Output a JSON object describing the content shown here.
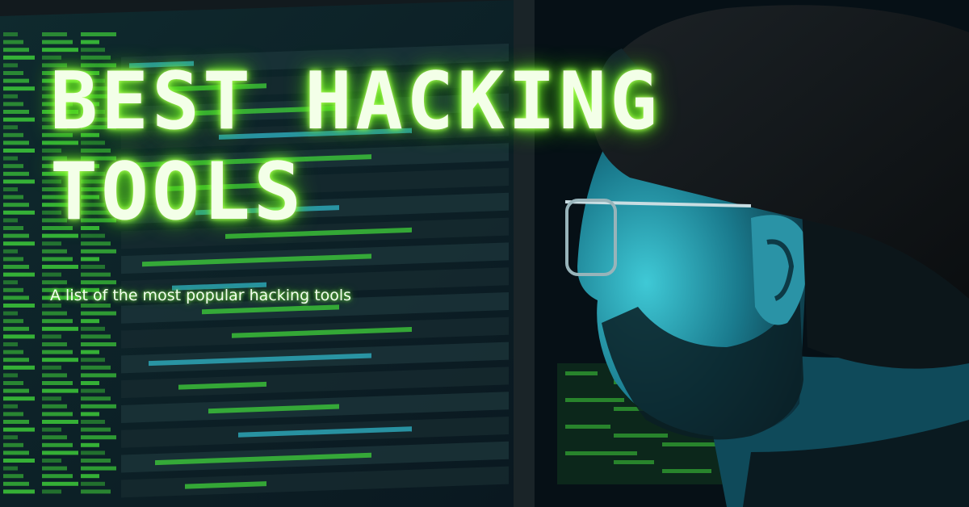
{
  "headline": {
    "line1": "BEST HACKING",
    "line2": "TOOLS"
  },
  "subtitle": "A list of the most popular hacking tools",
  "photo": {
    "subject": "person-in-cap-and-glasses-icon",
    "background": "terminal-monitor-icon"
  },
  "colors": {
    "glow_green": "#7cff2e",
    "terminal_green": "#3fd23a",
    "cyan_light": "#2fb6c8",
    "background": "#05101a"
  }
}
